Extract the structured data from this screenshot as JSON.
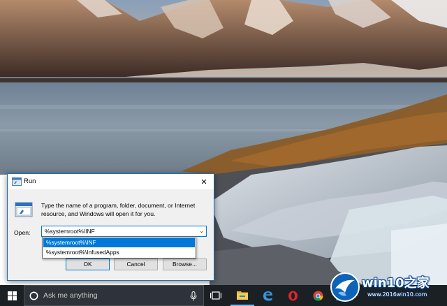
{
  "run_dialog": {
    "title": "Run",
    "close_glyph": "✕",
    "description": "Type the name of a program, folder, document, or Internet resource, and Windows will open it for you.",
    "open_label": "Open:",
    "open_value": "%systemroot%\\INF",
    "ok_label": "OK",
    "cancel_label": "Cancel",
    "browse_label": "Browse..."
  },
  "autocomplete": {
    "items": [
      "%systemroot%\\INF",
      "%systemroot%\\InfusedApps"
    ],
    "selected_index": 0
  },
  "taskbar": {
    "search_placeholder": "Ask me anything",
    "pinned": [
      "task-view-icon",
      "file-explorer-icon",
      "edge-icon",
      "opera-icon",
      "chrome-icon",
      "store-icon"
    ]
  },
  "watermark": {
    "brand": "win10之家",
    "url": "www.2016win10.com"
  },
  "colors": {
    "accent": "#0078d7",
    "taskbar": "#1b2025",
    "watermark_blue": "#0066cc"
  }
}
